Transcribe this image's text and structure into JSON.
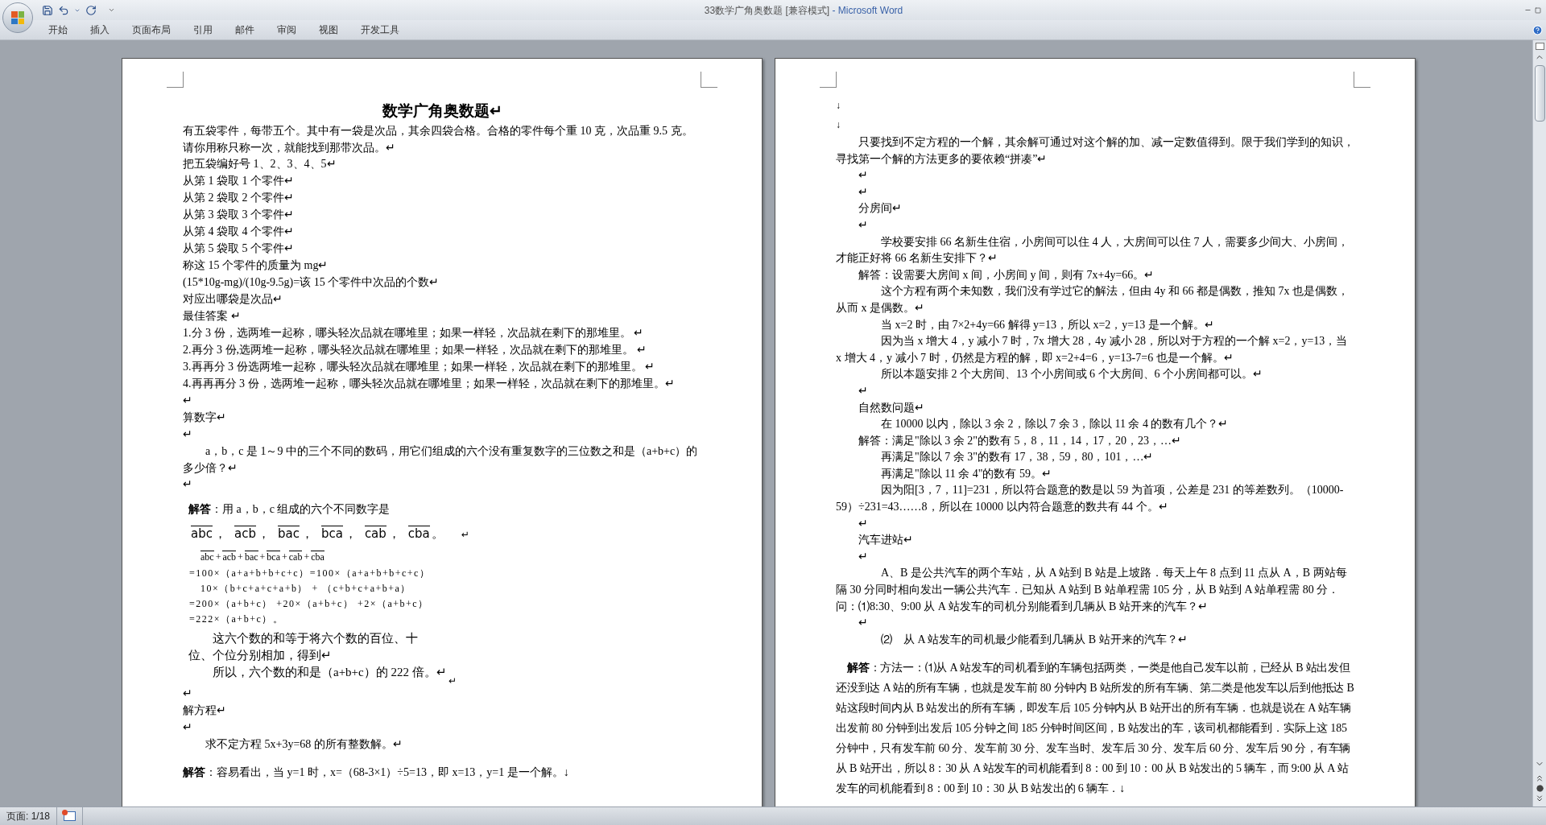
{
  "window": {
    "title": "33数学广角奥数题 [兼容模式]",
    "app": " - Microsoft Word"
  },
  "ribbon_tabs": [
    {
      "label": "开始",
      "selected": false
    },
    {
      "label": "插入",
      "selected": false
    },
    {
      "label": "页面布局",
      "selected": false
    },
    {
      "label": "引用",
      "selected": false
    },
    {
      "label": "邮件",
      "selected": false
    },
    {
      "label": "审阅",
      "selected": false
    },
    {
      "label": "视图",
      "selected": false
    },
    {
      "label": "开发工具",
      "selected": false
    }
  ],
  "pages": [
    {
      "paragraphs": [
        {
          "kind": "title",
          "text": "数学广角奥数题↵"
        },
        {
          "kind": "plain",
          "text": "有五袋零件，每带五个。其中有一袋是次品，其余四袋合格。合格的零件每个重 10 克，次品重 9.5 克。请你用称只称一次，就能找到那带次品。↵"
        },
        {
          "kind": "plain",
          "text": "把五袋编好号 1、2、3、4、5↵"
        },
        {
          "kind": "plain",
          "text": "从第 1 袋取 1 个零件↵"
        },
        {
          "kind": "plain",
          "text": "从第 2 袋取 2 个零件↵"
        },
        {
          "kind": "plain",
          "text": "从第 3 袋取 3 个零件↵"
        },
        {
          "kind": "plain",
          "text": "从第 4 袋取 4 个零件↵"
        },
        {
          "kind": "plain",
          "text": "从第 5 袋取 5 个零件↵"
        },
        {
          "kind": "plain",
          "text": "称这 15 个零件的质量为 mg↵"
        },
        {
          "kind": "plain",
          "text": "(15*10g-mg)/(10g-9.5g)=该 15 个零件中次品的个数↵"
        },
        {
          "kind": "plain",
          "text": "对应出哪袋是次品↵"
        },
        {
          "kind": "plain",
          "text": "最佳答案 ↵"
        },
        {
          "kind": "plain",
          "text": "1.分 3 份，选两堆一起称，哪头轻次品就在哪堆里；如果一样轻，次品就在剩下的那堆里。 ↵"
        },
        {
          "kind": "plain",
          "text": "2.再分 3 份,选两堆一起称，哪头轻次品就在哪堆里；如果一样轻，次品就在剩下的那堆里。 ↵"
        },
        {
          "kind": "plain",
          "text": "3.再再分 3 份选两堆一起称，哪头轻次品就在哪堆里；如果一样轻，次品就在剩下的那堆里。 ↵"
        },
        {
          "kind": "plain",
          "text": "4.再再再分 3 份，选两堆一起称，哪头轻次品就在哪堆里；如果一样轻，次品就在剩下的那堆里。↵"
        },
        {
          "kind": "plain",
          "text": "↵"
        },
        {
          "kind": "plain",
          "text": "算数字↵"
        },
        {
          "kind": "plain",
          "text": "↵"
        },
        {
          "kind": "indent",
          "text": "a，b，c 是 1～9 中的三个不同的数码，用它们组成的六个没有重复数字的三位数之和是（a+b+c）的多少倍？↵"
        },
        {
          "kind": "plain",
          "text": "↵"
        },
        {
          "kind": "answer",
          "text": "**解答**：用 a，b，c 组成的六个不同数字是"
        },
        {
          "kind": "terms",
          "terms": [
            {
              "over": "abc",
              "after": "，"
            },
            {
              "over": "acb",
              "after": "，"
            },
            {
              "over": "bac",
              "after": "，"
            },
            {
              "over": "bca",
              "after": "，"
            },
            {
              "over": "cab",
              "after": "，"
            },
            {
              "over": "cba",
              "after": "。"
            }
          ],
          "tail": "↵"
        },
        {
          "kind": "sum",
          "terms": [
            {
              "over": "abc",
              "after": "+"
            },
            {
              "over": "acb",
              "after": "+"
            },
            {
              "over": "bac",
              "after": "+"
            },
            {
              "over": "bca",
              "after": "+"
            },
            {
              "over": "cab",
              "after": "+"
            },
            {
              "over": "cba"
            }
          ]
        },
        {
          "kind": "formula",
          "text": "=100×（a+a+b+b+c+c）=100×（a+a+b+b+c+c）"
        },
        {
          "kind": "formula2",
          "text": "10×（b+c+a+c+a+b） + （c+b+c+a+b+a）"
        },
        {
          "kind": "formula",
          "text": "=200×（a+b+c） +20×（a+b+c） +2×（a+b+c）"
        },
        {
          "kind": "formula",
          "text": "=222×（a+b+c）。"
        },
        {
          "kind": "narrow",
          "text": "这六个数的和等于将六个数的百位、十位、个位分别相加，得到↵"
        },
        {
          "kind": "narrow_tail",
          "text": "所以，六个数的和是（a+b+c）的 222 倍。↵"
        },
        {
          "kind": "mark",
          "text": "↵"
        },
        {
          "kind": "plain",
          "text": "↵"
        },
        {
          "kind": "plain",
          "text": "解方程↵"
        },
        {
          "kind": "plain",
          "text": "↵"
        },
        {
          "kind": "indent",
          "text": "求不定方程 5x+3y=68 的所有整数解。↵"
        },
        {
          "kind": "answer_gap",
          "text": "**解答**：容易看出，当 y=1 时，x=（68-3×1）÷5=13，即 x=13，y=1 是一个解。↓"
        }
      ]
    },
    {
      "paragraphs": [
        {
          "kind": "arrow",
          "text": "↓"
        },
        {
          "kind": "arrow",
          "text": "↓"
        },
        {
          "kind": "indent",
          "text": "只要找到不定方程的一个解，其余解可通过对这个解的加、减一定数值得到。限于我们学到的知识，寻找第一个解的方法更多的要依赖“拼凑”↵"
        },
        {
          "kind": "sub",
          "text": "↵"
        },
        {
          "kind": "sub",
          "text": "↵"
        },
        {
          "kind": "sub",
          "text": "分房间↵"
        },
        {
          "kind": "sub",
          "text": "↵"
        },
        {
          "kind": "indent2",
          "text": "学校要安排 66 名新生住宿，小房间可以住 4 人，大房间可以住 7 人，需要多少间大、小房间，才能正好将 66 名新生安排下？↵"
        },
        {
          "kind": "sub",
          "text": "解答：设需要大房间 x 间，小房间 y 间，则有 7x+4y=66。↵"
        },
        {
          "kind": "indent2",
          "text": "这个方程有两个未知数，我们没有学过它的解法，但由 4y 和 66 都是偶数，推知 7x 也是偶数，从而 x 是偶数。↵"
        },
        {
          "kind": "indent2",
          "text": "当 x=2 时，由 7×2+4y=66 解得 y=13，所以 x=2，y=13 是一个解。↵"
        },
        {
          "kind": "indent2",
          "text": "因为当 x 增大 4，y 减小 7 时，7x 增大 28，4y 减小 28，所以对于方程的一个解 x=2，y=13，当 x 增大 4，y 减小 7 时，仍然是方程的解，即 x=2+4=6，y=13-7=6 也是一个解。↵"
        },
        {
          "kind": "indent2",
          "text": "所以本题安排 2 个大房间、13 个小房间或 6 个大房间、6 个小房间都可以。↵"
        },
        {
          "kind": "sub",
          "text": "↵"
        },
        {
          "kind": "sub",
          "text": "自然数问题↵"
        },
        {
          "kind": "indent2",
          "text": "在 10000 以内，除以 3 余 2，除以 7 余 3，除以 11 余 4 的数有几个？↵"
        },
        {
          "kind": "sub",
          "text": "解答：满足\"除以 3 余 2\"的数有 5，8，11，14，17，20，23，…↵"
        },
        {
          "kind": "indent2",
          "text": "再满足\"除以 7 余 3\"的数有 17，38，59，80，101，…↵"
        },
        {
          "kind": "indent2",
          "text": "再满足\"除以 11 余 4\"的数有 59。↵"
        },
        {
          "kind": "indent2",
          "text": "因为阳[3，7，11]=231，所以符合题意的数是以 59 为首项，公差是 231 的等差数列。（10000-59）÷231=43……8，所以在 10000 以内符合题意的数共有 44 个。↵"
        },
        {
          "kind": "sub",
          "text": "↵"
        },
        {
          "kind": "sub",
          "text": "汽车进站↵"
        },
        {
          "kind": "sub",
          "text": "↵"
        },
        {
          "kind": "indent2",
          "text": "A、B 是公共汽车的两个车站，从 A 站到 B 站是上坡路．每天上午 8 点到 11 点从 A，B 两站每隔 30 分同时相向发出一辆公共汽车．已知从 A 站到 B 站单程需 105 分，从 B 站到 A 站单程需 80 分．问：⑴8:30、9:00 从 A 站发车的司机分别能看到几辆从 B 站开来的汽车？↵"
        },
        {
          "kind": "sub",
          "text": "↵"
        },
        {
          "kind": "indent2",
          "text": "⑵　从 A 站发车的司机最少能看到几辆从 B 站开来的汽车？↵"
        },
        {
          "kind": "wide",
          "text": "**解答**：方法一：⑴从 A 站发车的司机看到的车辆包括两类，一类是他自己发车以前，已经从 B 站出发但还没到达 A 站的所有车辆，也就是发车前 80 分钟内 B 站所发的所有车辆、第二类是他发车以后到他抵达 B 站这段时间内从 B 站发出的所有车辆，即发车后 105 分钟内从 B 站开出的所有车辆．也就是说在 A 站车辆出发前 80 分钟到出发后 105 分钟之间 185 分钟时间区间，B 站发出的车，该司机都能看到．实际上这 185 分钟中，只有发车前 60 分、发车前 30 分、发车当时、发车后 30 分、发车后 60 分、发车后 90 分，有车辆从 B 站开出，所以 8：30 从 A 站发车的司机能看到 8：00 到 10：00 从 B 站发出的 5 辆车，而 9:00 从 A 站发车的司机能看到 8：00 到 10：30 从 B 站发出的 6 辆车．↓"
        }
      ]
    }
  ],
  "status_bar": {
    "page": "页面: 1/18"
  }
}
